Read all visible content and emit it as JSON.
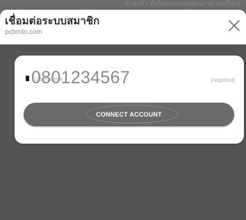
{
  "background": {
    "strip_text": "ย้านแก้ว  ตั้งถิ่นตามระบบคุณภาพ คนเป็นเน"
  },
  "sheet": {
    "title": "เชื่อมต่อระบบสมาชิก",
    "domain": "pcbmln.com",
    "close_icon": "close-icon"
  },
  "form": {
    "phone_icon": "phone-icon",
    "field_label": "Username",
    "phone_value": "0801234567",
    "required_hint": "(required)"
  },
  "actions": {
    "connect_label": "CONNECT ACCOUNT"
  },
  "colors": {
    "overlay": "#545454",
    "card": "#ffffff",
    "button": "#6a6a6a",
    "title": "#2b2b2b"
  }
}
